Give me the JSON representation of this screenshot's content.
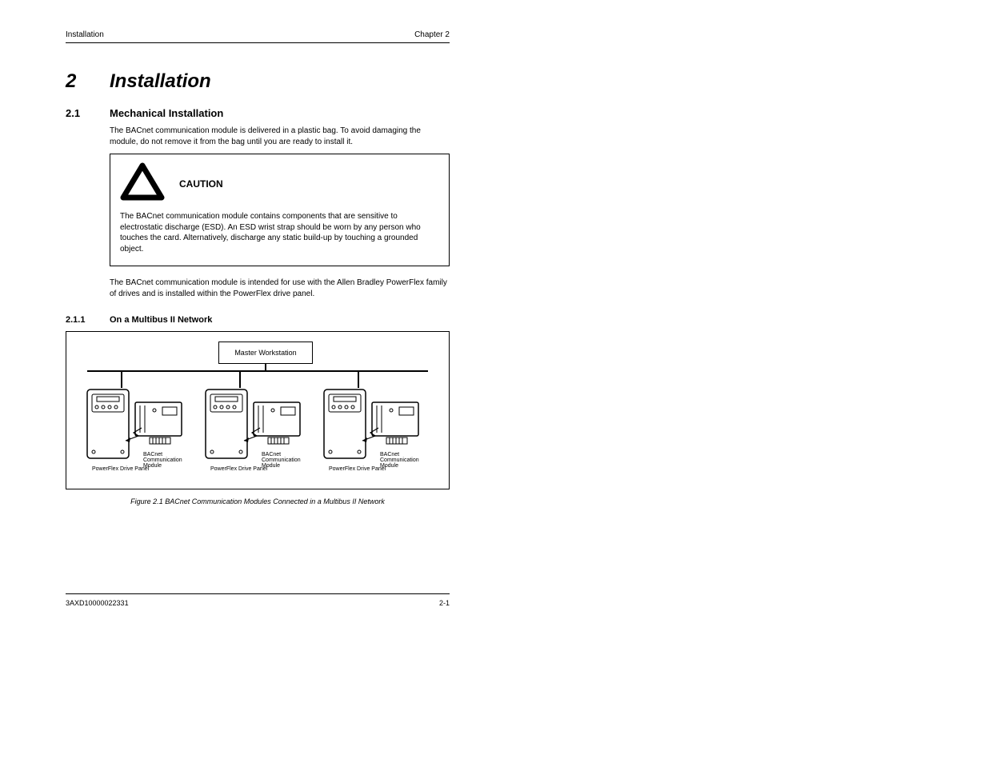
{
  "header": {
    "left": "Installation",
    "right": "Chapter 2"
  },
  "chapter": {
    "num": "2",
    "title": "Installation"
  },
  "section21": {
    "num": "2.1",
    "title": "Mechanical Installation",
    "body1": "The BACnet communication module is delivered in a plastic bag. To avoid damaging the module, do not remove it from the bag until you are ready to install it.",
    "callout_label": "CAUTION",
    "callout_text": "The BACnet communication module contains components that are sensitive to electrostatic discharge (ESD). An ESD wrist strap should be worn by any person who touches the card. Alternatively, discharge any static build-up by touching a grounded object.",
    "body2": "The BACnet communication module is intended for use with the Allen Bradley PowerFlex family of drives and is installed within the PowerFlex drive panel."
  },
  "section211": {
    "num": "2.1.1",
    "title": "On a Multibus II Network"
  },
  "figure": {
    "master_label": "Master Workstation",
    "panel_label": "PowerFlex Drive Panel",
    "module_label": "BACnet Communication Module",
    "caption": "Figure 2.1 BACnet Communication Modules Connected in a Multibus II Network"
  },
  "footer": {
    "left": "3AXD10000022331",
    "right": "2-1"
  }
}
